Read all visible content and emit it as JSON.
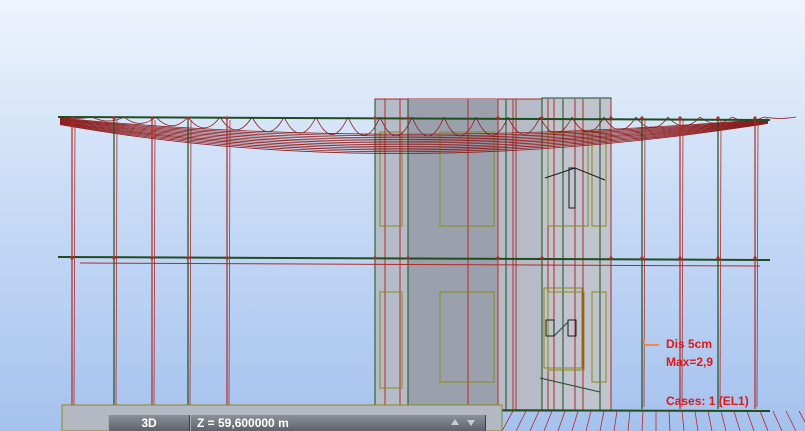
{
  "viewport": {
    "background_top": "#eef4fd",
    "background_bottom": "#a5c2ee",
    "colors": {
      "deformed_mesh": "#8b1a1a",
      "frame_green": "#1f4d1f",
      "bar_red": "#b02a2a",
      "panel_olive": "#8a8a1a",
      "wall_gray": "#a9b0bc",
      "legend_text": "#e01818"
    }
  },
  "legend": {
    "icon": "displacement-scale-icon",
    "dis_label": "Dis  5cm",
    "max_label": "Max=2,9",
    "cases_label": "Cases: 1 (EL1)"
  },
  "statusbar": {
    "view_mode": "3D",
    "z_coordinate": "Z = 59,600000 m",
    "up_icon": "arrow-up-icon",
    "down_icon": "arrow-down-icon"
  }
}
